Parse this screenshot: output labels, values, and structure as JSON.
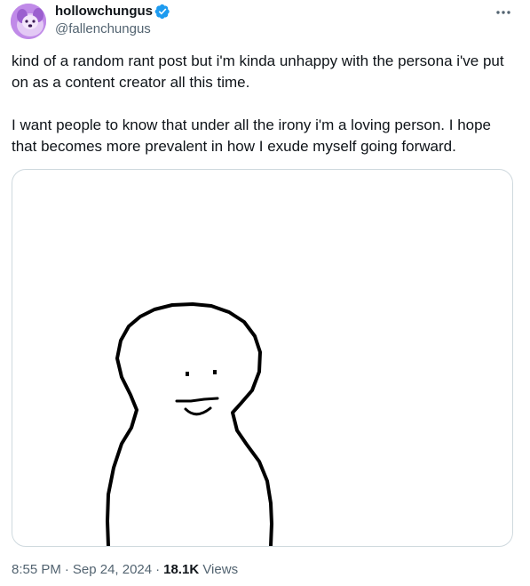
{
  "author": {
    "display_name": "hollowchungus",
    "handle": "@fallenchungus",
    "verified": true,
    "avatar_icon": "purple-dog-avatar"
  },
  "menu": {
    "more_icon": "ellipsis-icon"
  },
  "post": {
    "paragraphs": [
      "kind of a random rant post but i'm kinda unhappy with the persona i've put on as a content creator all this time.",
      "I want people to know that under all the irony i'm a loving person. I hope that becomes more prevalent in how I exude myself going forward."
    ],
    "media_description_icon": "smiling-stick-figure-drawing"
  },
  "meta": {
    "time": "8:55 PM",
    "date": "Sep 24, 2024",
    "separator": "·",
    "views_count": "18.1K",
    "views_label": "Views"
  },
  "colors": {
    "text_primary": "#0f1419",
    "text_secondary": "#536471",
    "verified_blue": "#1d9bf0",
    "media_border": "#cfd9de",
    "avatar_purple": "#b57be0"
  }
}
